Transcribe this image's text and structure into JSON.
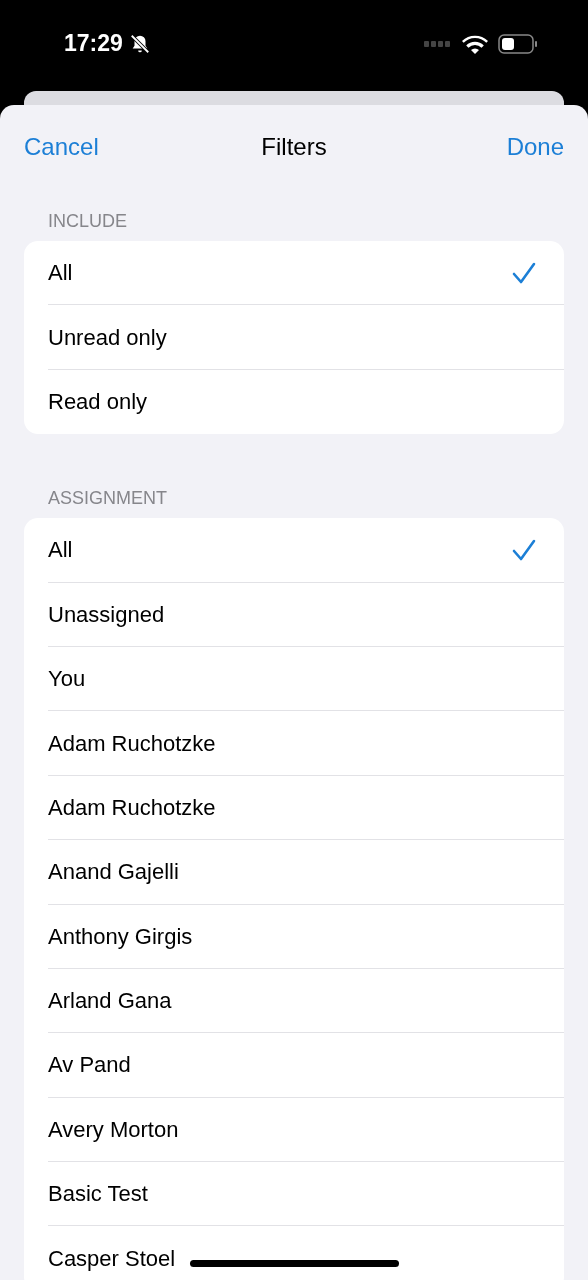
{
  "status_bar": {
    "time": "17:29"
  },
  "nav": {
    "cancel": "Cancel",
    "title": "Filters",
    "done": "Done"
  },
  "sections": [
    {
      "header": "INCLUDE",
      "items": [
        {
          "label": "All",
          "selected": true
        },
        {
          "label": "Unread only",
          "selected": false
        },
        {
          "label": "Read only",
          "selected": false
        }
      ]
    },
    {
      "header": "ASSIGNMENT",
      "items": [
        {
          "label": "All",
          "selected": true
        },
        {
          "label": "Unassigned",
          "selected": false
        },
        {
          "label": "You",
          "selected": false
        },
        {
          "label": "Adam Ruchotzke",
          "selected": false
        },
        {
          "label": "Adam Ruchotzke",
          "selected": false
        },
        {
          "label": "Anand Gajelli",
          "selected": false
        },
        {
          "label": "Anthony Girgis",
          "selected": false
        },
        {
          "label": "Arland Gana",
          "selected": false
        },
        {
          "label": "Av Pand",
          "selected": false
        },
        {
          "label": "Avery Morton",
          "selected": false
        },
        {
          "label": "Basic Test",
          "selected": false
        },
        {
          "label": "Casper Stoel",
          "selected": false
        }
      ]
    }
  ]
}
